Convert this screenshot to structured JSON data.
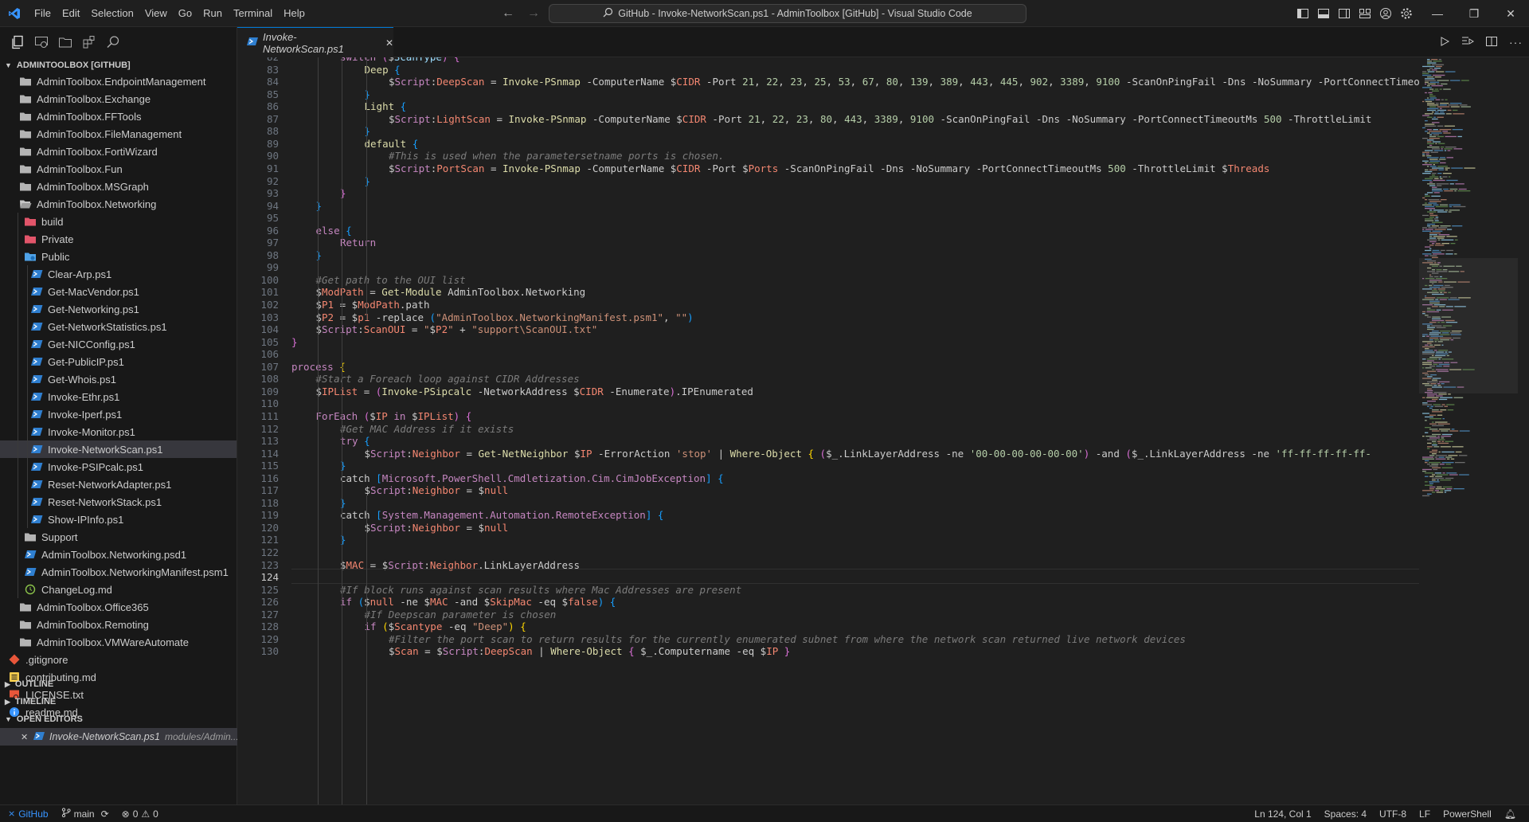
{
  "window": {
    "title": "GitHub - Invoke-NetworkScan.ps1 - AdminToolbox [GitHub] - Visual Studio Code",
    "menu": [
      "File",
      "Edit",
      "Selection",
      "View",
      "Go",
      "Run",
      "Terminal",
      "Help"
    ],
    "controls": [
      "minimize-icon",
      "restore-icon",
      "close-icon"
    ]
  },
  "sidebar": {
    "root_label": "ADMINTOOLBOX [GITHUB]",
    "items": [
      {
        "label": "AdminToolbox.EndpointManagement",
        "icon": "folder-icon",
        "depth": 1
      },
      {
        "label": "AdminToolbox.Exchange",
        "icon": "folder-icon",
        "depth": 1
      },
      {
        "label": "AdminToolbox.FFTools",
        "icon": "folder-icon",
        "depth": 1
      },
      {
        "label": "AdminToolbox.FileManagement",
        "icon": "folder-icon",
        "depth": 1
      },
      {
        "label": "AdminToolbox.FortiWizard",
        "icon": "folder-icon",
        "depth": 1
      },
      {
        "label": "AdminToolbox.Fun",
        "icon": "folder-icon",
        "depth": 1
      },
      {
        "label": "AdminToolbox.MSGraph",
        "icon": "folder-icon",
        "depth": 1
      },
      {
        "label": "AdminToolbox.Networking",
        "icon": "folder-open-icon",
        "depth": 1
      },
      {
        "label": "build",
        "icon": "folder-red-icon",
        "depth": 2
      },
      {
        "label": "Private",
        "icon": "folder-red-icon",
        "depth": 2
      },
      {
        "label": "Public",
        "icon": "folder-blue-icon",
        "depth": 2
      },
      {
        "label": "Clear-Arp.ps1",
        "icon": "powershell-icon",
        "depth": 3
      },
      {
        "label": "Get-MacVendor.ps1",
        "icon": "powershell-icon",
        "depth": 3
      },
      {
        "label": "Get-Networking.ps1",
        "icon": "powershell-icon",
        "depth": 3
      },
      {
        "label": "Get-NetworkStatistics.ps1",
        "icon": "powershell-icon",
        "depth": 3
      },
      {
        "label": "Get-NICConfig.ps1",
        "icon": "powershell-icon",
        "depth": 3
      },
      {
        "label": "Get-PublicIP.ps1",
        "icon": "powershell-icon",
        "depth": 3
      },
      {
        "label": "Get-Whois.ps1",
        "icon": "powershell-icon",
        "depth": 3
      },
      {
        "label": "Invoke-Ethr.ps1",
        "icon": "powershell-icon",
        "depth": 3
      },
      {
        "label": "Invoke-Iperf.ps1",
        "icon": "powershell-icon",
        "depth": 3
      },
      {
        "label": "Invoke-Monitor.ps1",
        "icon": "powershell-icon",
        "depth": 3
      },
      {
        "label": "Invoke-NetworkScan.ps1",
        "icon": "powershell-icon",
        "depth": 3,
        "active": true
      },
      {
        "label": "Invoke-PSIPcalc.ps1",
        "icon": "powershell-icon",
        "depth": 3
      },
      {
        "label": "Reset-NetworkAdapter.ps1",
        "icon": "powershell-icon",
        "depth": 3
      },
      {
        "label": "Reset-NetworkStack.ps1",
        "icon": "powershell-icon",
        "depth": 3
      },
      {
        "label": "Show-IPInfo.ps1",
        "icon": "powershell-icon",
        "depth": 3
      },
      {
        "label": "Support",
        "icon": "folder-icon",
        "depth": 2
      },
      {
        "label": "AdminToolbox.Networking.psd1",
        "icon": "powershell-icon",
        "depth": 2
      },
      {
        "label": "AdminToolbox.NetworkingManifest.psm1",
        "icon": "powershell-icon",
        "depth": 2
      },
      {
        "label": "ChangeLog.md",
        "icon": "history-icon",
        "depth": 2
      },
      {
        "label": "AdminToolbox.Office365",
        "icon": "folder-icon",
        "depth": 1
      },
      {
        "label": "AdminToolbox.Remoting",
        "icon": "folder-icon",
        "depth": 1
      },
      {
        "label": "AdminToolbox.VMWareAutomate",
        "icon": "folder-icon",
        "depth": 1
      },
      {
        "label": ".gitignore",
        "icon": "git-icon",
        "depth": 0
      },
      {
        "label": "contributing.md",
        "icon": "markdown-yellow-icon",
        "depth": 0
      },
      {
        "label": "LICENSE.txt",
        "icon": "license-icon",
        "depth": 0
      },
      {
        "label": "readme.md",
        "icon": "info-icon",
        "depth": 0
      }
    ],
    "sections": {
      "outline": "OUTLINE",
      "timeline": "TIMELINE",
      "open_editors": "OPEN EDITORS"
    },
    "open_editor": {
      "file": "Invoke-NetworkScan.ps1",
      "path": "modules/Admin..."
    }
  },
  "tab": {
    "label": "Invoke-NetworkScan.ps1"
  },
  "editor": {
    "current_line": 124,
    "lines": [
      {
        "n": 82,
        "indent": 2,
        "html": "<span class='kw'>switch</span> <span class='b2'>(</span><span class='dol'>$</span><span class='var'>ScanType</span><span class='b2'>)</span> <span class='b2'>{</span>"
      },
      {
        "n": 83,
        "indent": 3,
        "html": "<span class='fn'>Deep</span> <span class='b3'>{</span>"
      },
      {
        "n": 84,
        "indent": 4,
        "html": "<span class='dol'>$</span><span class='scope'>Script</span>:<span class='var' style='color:#f48771'>DeepScan</span> = <span class='fn'>Invoke-PSnmap</span> -ComputerName <span class='dol'>$</span><span class='var' style='color:#f48771'>CIDR</span> -Port <span class='num'>21</span>, <span class='num'>22</span>, <span class='num'>23</span>, <span class='num'>25</span>, <span class='num'>53</span>, <span class='num'>67</span>, <span class='num'>80</span>, <span class='num'>139</span>, <span class='num'>389</span>, <span class='num'>443</span>, <span class='num'>445</span>, <span class='num'>902</span>, <span class='num'>3389</span>, <span class='num'>9100</span> -ScanOnPingFail -Dns -NoSummary -PortConnectTimeoutMs"
      },
      {
        "n": 85,
        "indent": 3,
        "html": "<span class='b3'>}</span>"
      },
      {
        "n": 86,
        "indent": 3,
        "html": "<span class='fn'>Light</span> <span class='b3'>{</span>"
      },
      {
        "n": 87,
        "indent": 4,
        "html": "<span class='dol'>$</span><span class='scope'>Script</span>:<span class='var' style='color:#f48771'>LightScan</span> = <span class='fn'>Invoke-PSnmap</span> -ComputerName <span class='dol'>$</span><span class='var' style='color:#f48771'>CIDR</span> -Port <span class='num'>21</span>, <span class='num'>22</span>, <span class='num'>23</span>, <span class='num'>80</span>, <span class='num'>443</span>, <span class='num'>3389</span>, <span class='num'>9100</span> -ScanOnPingFail -Dns -NoSummary -PortConnectTimeoutMs <span class='num'>500</span> -ThrottleLimit"
      },
      {
        "n": 88,
        "indent": 3,
        "html": "<span class='b3'>}</span>"
      },
      {
        "n": 89,
        "indent": 3,
        "html": "<span class='fn'>default</span> <span class='b3'>{</span>"
      },
      {
        "n": 90,
        "indent": 4,
        "html": "<span class='cmg'>#This is used when the parametersetname ports is chosen.</span>"
      },
      {
        "n": 91,
        "indent": 4,
        "html": "<span class='dol'>$</span><span class='scope'>Script</span>:<span class='var' style='color:#f48771'>PortScan</span> = <span class='fn'>Invoke-PSnmap</span> -ComputerName <span class='dol'>$</span><span class='var' style='color:#f48771'>CIDR</span> -Port <span class='dol'>$</span><span class='var' style='color:#f48771'>Ports</span> -ScanOnPingFail -Dns -NoSummary -PortConnectTimeoutMs <span class='num'>500</span> -ThrottleLimit <span class='dol'>$</span><span class='var' style='color:#f48771'>Threads</span>"
      },
      {
        "n": 92,
        "indent": 3,
        "html": "<span class='b3'>}</span>"
      },
      {
        "n": 93,
        "indent": 2,
        "html": "<span class='b2'>}</span>"
      },
      {
        "n": 94,
        "indent": 1,
        "html": "<span class='b3'>}</span>"
      },
      {
        "n": 95,
        "indent": 0,
        "html": ""
      },
      {
        "n": 96,
        "indent": 1,
        "html": "<span class='kw'>else</span> <span class='b3'>{</span>"
      },
      {
        "n": 97,
        "indent": 2,
        "html": "<span class='kw'>Return</span>"
      },
      {
        "n": 98,
        "indent": 1,
        "html": "<span class='b3'>}</span>"
      },
      {
        "n": 99,
        "indent": 0,
        "html": ""
      },
      {
        "n": 100,
        "indent": 1,
        "html": "<span class='cmg'>#Get path to the OUI list</span>"
      },
      {
        "n": 101,
        "indent": 1,
        "html": "<span class='dol'>$</span><span class='var' style='color:#f48771'>ModPath</span> = <span class='fn'>Get-Module</span> AdminToolbox.Networking"
      },
      {
        "n": 102,
        "indent": 1,
        "html": "<span class='dol'>$</span><span class='var' style='color:#f48771'>P1</span> = <span class='dol'>$</span><span class='var' style='color:#f48771'>ModPath</span>.path"
      },
      {
        "n": 103,
        "indent": 1,
        "html": "<span class='dol'>$</span><span class='var' style='color:#f48771'>P2</span> = <span class='dol'>$</span><span class='var' style='color:#f48771'>p1</span> -replace <span class='b3'>(</span><span class='str'>\"AdminToolbox.NetworkingManifest.psm1\"</span>, <span class='str'>\"\"</span><span class='b3'>)</span>"
      },
      {
        "n": 104,
        "indent": 1,
        "html": "<span class='dol'>$</span><span class='scope'>Script</span>:<span class='var' style='color:#f48771'>ScanOUI</span> = <span class='str'>\"</span><span class='dol'>$</span><span class='var' style='color:#f48771'>P2</span><span class='str'>\"</span> + <span class='str'>\"support\\ScanOUI.txt\"</span>"
      },
      {
        "n": 105,
        "indent": 0,
        "html": "<span class='b2'>}</span>"
      },
      {
        "n": 106,
        "indent": 0,
        "html": ""
      },
      {
        "n": 107,
        "indent": 0,
        "html": "<span class='kw'>process</span> <span class='b1'>{</span>"
      },
      {
        "n": 108,
        "indent": 1,
        "html": "<span class='cmg'>#Start a Foreach loop against CIDR Addresses</span>"
      },
      {
        "n": 109,
        "indent": 1,
        "html": "<span class='dol'>$</span><span class='var' style='color:#f48771'>IPList</span> = <span class='b2'>(</span><span class='fn'>Invoke-PSipcalc</span> -NetworkAddress <span class='dol'>$</span><span class='var' style='color:#f48771'>CIDR</span> -Enumerate<span class='b2'>)</span>.IPEnumerated"
      },
      {
        "n": 110,
        "indent": 0,
        "html": ""
      },
      {
        "n": 111,
        "indent": 1,
        "html": "<span class='kw'>ForEach</span> <span class='b2'>(</span><span class='dol'>$</span><span class='var' style='color:#f48771'>IP</span> <span class='kw'>in</span> <span class='dol'>$</span><span class='var' style='color:#f48771'>IPList</span><span class='b2'>)</span> <span class='b2'>{</span>"
      },
      {
        "n": 112,
        "indent": 2,
        "html": "<span class='cmg'>#Get MAC Address if it exists</span>"
      },
      {
        "n": 113,
        "indent": 2,
        "html": "<span class='kw'>try</span> <span class='b3'>{</span>"
      },
      {
        "n": 114,
        "indent": 3,
        "html": "<span class='dol'>$</span><span class='scope'>Script</span>:<span class='var' style='color:#f48771'>Neighbor</span> = <span class='fn'>Get-NetNeighbor</span> <span class='dol'>$</span><span class='var' style='color:#f48771'>IP</span> -ErrorAction <span class='str'>'stop'</span> | <span class='fn'>Where-Object</span> <span class='b1'>{</span> <span class='b2'>(</span><span class='dol'>$</span>_.LinkLayerAddress -ne <span class='str' style='color:#b5cea8'>'00-00-00-00-00-00'</span><span class='b2'>)</span> -and <span class='b2'>(</span><span class='dol'>$</span>_.LinkLayerAddress -ne <span class='str' style='color:#b5cea8'>'ff-ff-ff-ff-ff-</span>"
      },
      {
        "n": 115,
        "indent": 2,
        "html": "<span class='b3'>}</span>"
      },
      {
        "n": 116,
        "indent": 2,
        "html": "catch <span class='b3'>[</span><span class='type' style='color:#c586c0'>Microsoft.PowerShell.Cmdletization.Cim.CimJobException</span><span class='b3'>]</span> <span class='b3'>{</span>"
      },
      {
        "n": 117,
        "indent": 3,
        "html": "<span class='dol'>$</span><span class='scope'>Script</span>:<span class='var' style='color:#f48771'>Neighbor</span> = <span class='dol'>$</span><span class='var' style='color:#f48771'>null</span>"
      },
      {
        "n": 118,
        "indent": 2,
        "html": "<span class='b3'>}</span>"
      },
      {
        "n": 119,
        "indent": 2,
        "html": "catch <span class='b3'>[</span><span class='type' style='color:#c586c0'>System.Management.Automation.RemoteException</span><span class='b3'>]</span> <span class='b3'>{</span>"
      },
      {
        "n": 120,
        "indent": 3,
        "html": "<span class='dol'>$</span><span class='scope'>Script</span>:<span class='var' style='color:#f48771'>Neighbor</span> = <span class='dol'>$</span><span class='var' style='color:#f48771'>null</span>"
      },
      {
        "n": 121,
        "indent": 2,
        "html": "<span class='b3'>}</span>"
      },
      {
        "n": 122,
        "indent": 0,
        "html": ""
      },
      {
        "n": 123,
        "indent": 2,
        "html": "<span class='dol'>$</span><span class='var' style='color:#f48771'>MAC</span> = <span class='dol'>$</span><span class='scope'>Script</span>:<span class='var' style='color:#f48771'>Neighbor</span>.LinkLayerAddress"
      },
      {
        "n": 124,
        "indent": 0,
        "html": ""
      },
      {
        "n": 125,
        "indent": 2,
        "html": "<span class='cmg'>#If block runs against scan results where Mac Addresses are present</span>"
      },
      {
        "n": 126,
        "indent": 2,
        "html": "<span class='kw'>if</span> <span class='b3'>(</span><span class='dol'>$</span><span class='var' style='color:#f48771'>null</span> -ne <span class='dol'>$</span><span class='var' style='color:#f48771'>MAC</span> -and <span class='dol'>$</span><span class='var' style='color:#f48771'>SkipMac</span> -eq <span class='dol'>$</span><span class='var' style='color:#f48771'>false</span><span class='b3'>)</span> <span class='b3'>{</span>"
      },
      {
        "n": 127,
        "indent": 3,
        "html": "<span class='cmg'>#If Deepscan parameter is chosen</span>"
      },
      {
        "n": 128,
        "indent": 3,
        "html": "<span class='kw'>if</span> <span class='b1'>(</span><span class='dol'>$</span><span class='var' style='color:#f48771'>Scantype</span> -eq <span class='str'>\"Deep\"</span><span class='b1'>)</span> <span class='b1'>{</span>"
      },
      {
        "n": 129,
        "indent": 4,
        "html": "<span class='cmg'>#Filter the port scan to return results for the currently enumerated subnet from where the network scan returned live network devices</span>"
      },
      {
        "n": 130,
        "indent": 4,
        "html": "<span class='dol'>$</span><span class='var' style='color:#f48771'>Scan</span> = <span class='dol'>$</span><span class='scope'>Script</span>:<span class='var' style='color:#f48771'>DeepScan</span> | <span class='fn'>Where-Object</span> <span class='b2'>{</span> <span class='dol'>$</span>_.Computername -eq <span class='dol'>$</span><span class='var' style='color:#f48771'>IP</span> <span class='b2'>}</span>"
      }
    ]
  },
  "statusbar": {
    "remote": "GitHub",
    "branch": "main",
    "errors": "0",
    "warnings": "0",
    "position": "Ln 124, Col 1",
    "spaces": "Spaces: 4",
    "encoding": "UTF-8",
    "eol": "LF",
    "language": "PowerShell"
  },
  "colors": {
    "accent": "#0078d4",
    "remote": "#3794ff",
    "powershell": "#2f7fd0"
  }
}
